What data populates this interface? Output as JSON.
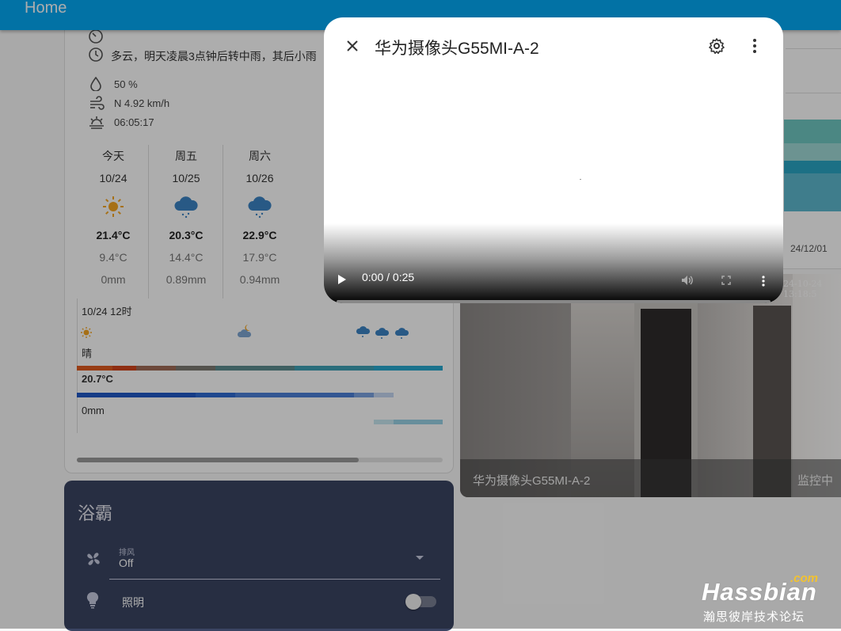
{
  "appbar": {
    "title": "Home"
  },
  "weather": {
    "forecast_text": "多云，明天凌晨3点钟后转中雨，其后小雨",
    "humidity": "50 %",
    "wind": "N 4.92 km/h",
    "sunrise": "06:05:17",
    "days": [
      {
        "label": "今天",
        "date": "10/24",
        "icon": "sunny-icon",
        "high": "21.4°C",
        "low": "9.4°C",
        "precip": "0mm"
      },
      {
        "label": "周五",
        "date": "10/25",
        "icon": "rain-cloud-icon",
        "high": "20.3°C",
        "low": "14.4°C",
        "precip": "0.89mm"
      },
      {
        "label": "周六",
        "date": "10/26",
        "icon": "rain-cloud-icon",
        "high": "22.9°C",
        "low": "17.9°C",
        "precip": "0.94mm"
      }
    ],
    "hourly": {
      "time_label": "10/24 12时",
      "condition": "晴",
      "temp": "20.7°C",
      "precip": "0mm"
    }
  },
  "bath": {
    "name": "浴霸",
    "fan_label": "排风",
    "fan_value": "Off",
    "light_label": "照明"
  },
  "chart_card": {
    "date_label": "24/12/01"
  },
  "camera": {
    "timestamp": "24-10-24 13:18:5",
    "name": "华为摄像头G55MI-A-2",
    "status": "监控中"
  },
  "dialog": {
    "title": "华为摄像头G55MI-A-2",
    "video_time": "0:00 / 0:25"
  },
  "watermark": {
    "com": ".com",
    "brand": "Hassbian",
    "sub": "瀚思彼岸技术论坛"
  },
  "colors": {
    "appbar": "#03a9f4",
    "bath_card": "#3a4462",
    "sun": "#f5a623",
    "rain": "#3b84c4"
  }
}
